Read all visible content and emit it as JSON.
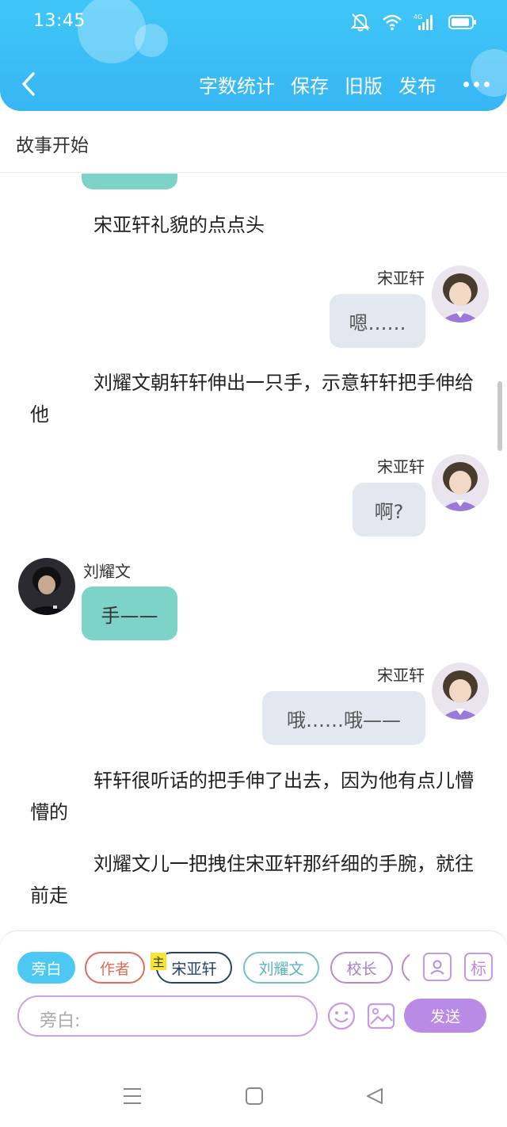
{
  "status_bar": {
    "time": "13:45"
  },
  "header": {
    "back_icon": "chevron-left-icon",
    "actions": [
      "字数统计",
      "保存",
      "旧版",
      "发布"
    ],
    "more_icon": "more-dots-icon"
  },
  "title": "故事开始",
  "messages": [
    {
      "type": "narration",
      "text": "宋亚轩礼貌的点点头"
    },
    {
      "type": "bubble",
      "side": "right",
      "name": "宋亚轩",
      "text": "嗯……"
    },
    {
      "type": "narration",
      "text": "刘耀文朝轩轩伸出一只手，示意轩轩把手伸给他"
    },
    {
      "type": "bubble",
      "side": "right",
      "name": "宋亚轩",
      "text": "啊?"
    },
    {
      "type": "bubble",
      "side": "left",
      "name": "刘耀文",
      "text": "手——"
    },
    {
      "type": "bubble",
      "side": "right",
      "name": "宋亚轩",
      "text": "哦……哦——"
    },
    {
      "type": "narration",
      "text": "轩轩很听话的把手伸了出去，因为他有点儿懵懵的"
    },
    {
      "type": "narration",
      "text": "刘耀文儿一把拽住宋亚轩那纤细的手腕，就往前走"
    }
  ],
  "roles": [
    "旁白",
    "作者",
    "宋亚轩",
    "刘耀文",
    "校长"
  ],
  "main_tag": "主",
  "role_icon": "person-card-icon",
  "tag_button": "标",
  "input": {
    "placeholder": "旁白:"
  },
  "emoji_icon": "smiley-icon",
  "image_icon": "image-icon",
  "send_label": "发送",
  "colors": {
    "header": "#3fc6f7",
    "teal_bubble": "#7dd3c7",
    "gray_bubble": "#e3e7ef",
    "send": "#b98be6"
  }
}
